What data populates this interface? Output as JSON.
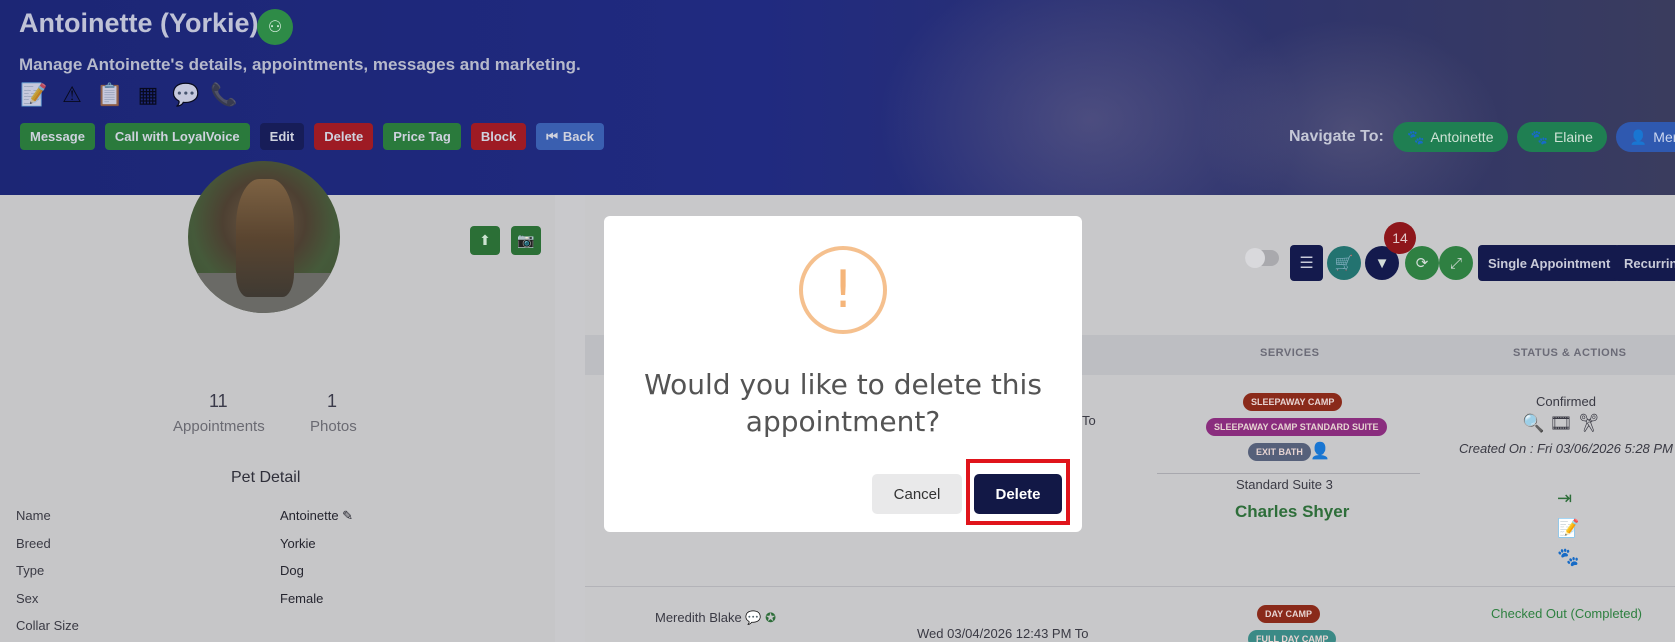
{
  "header": {
    "title": "Antoinette (Yorkie)",
    "subtitle": "Manage Antoinette's details, appointments, messages and marketing.",
    "buttons": [
      "Message",
      "Call with LoyalVoice",
      "Edit",
      "Delete",
      "Price Tag",
      "Block",
      "Back"
    ],
    "navigate_label": "Navigate To:",
    "nav_pills": [
      "Antoinette",
      "Elaine",
      "Meredit"
    ]
  },
  "pet_card": {
    "stats": [
      {
        "value": "11",
        "label": "Appointments"
      },
      {
        "value": "1",
        "label": "Photos"
      }
    ],
    "section_title": "Pet Detail",
    "details": [
      {
        "label": "Name",
        "value": "Antoinette"
      },
      {
        "label": "Breed",
        "value": "Yorkie"
      },
      {
        "label": "Type",
        "value": "Dog"
      },
      {
        "label": "Sex",
        "value": "Female"
      },
      {
        "label": "Collar Size",
        "value": ""
      }
    ]
  },
  "appointments": {
    "filter_count": "14",
    "single_btn": "Single Appointment",
    "recurring_btn": "Recurring",
    "columns": [
      "SERVICES",
      "STATUS & ACTIONS"
    ],
    "row1": {
      "tags": [
        "SLEEPAWAY CAMP",
        "SLEEPAWAY CAMP STANDARD SUITE",
        "EXIT BATH"
      ],
      "room": "Standard Suite 3",
      "staff": "Charles Shyer",
      "status": "Confirmed",
      "created": "Created On : Fri 03/06/2026 5:28 PM",
      "to_fragment": "To"
    },
    "row2": {
      "owner": "Meredith Blake",
      "date": "Wed 03/04/2026 12:43 PM To",
      "tags": [
        "DAY CAMP",
        "FULL DAY CAMP"
      ],
      "status": "Checked Out (Completed)"
    }
  },
  "modal": {
    "question": "Would you like to delete this appointment?",
    "cancel": "Cancel",
    "delete": "Delete"
  },
  "colors": {
    "header_navy": "#1c2675",
    "green": "#2a7a3c",
    "red": "#9e1b24",
    "delete_btn": "#121846",
    "warn_orange": "#f5c08e",
    "highlight_red": "#e0141b"
  }
}
